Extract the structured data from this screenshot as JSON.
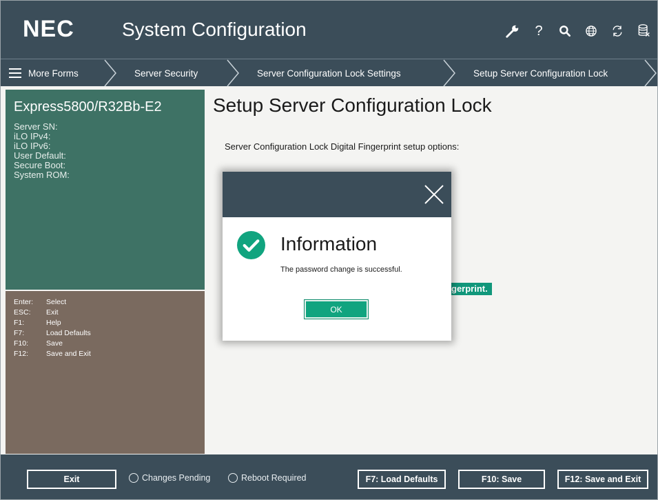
{
  "header": {
    "logo": "NEC",
    "title": "System Configuration",
    "icons": [
      "wrench-icon",
      "help-icon",
      "search-icon",
      "globe-icon",
      "refresh-icon",
      "database-icon"
    ],
    "help_glyph": "?"
  },
  "breadcrumb": {
    "menu_label": "More Forms",
    "items": [
      {
        "label": "Server Security"
      },
      {
        "label": "Server Configuration Lock Settings"
      },
      {
        "label": "Setup Server Configuration Lock"
      }
    ]
  },
  "system": {
    "model": "Express5800/R32Bb-E2",
    "fields": [
      "Server SN:",
      "iLO IPv4:",
      "iLO IPv6:",
      "User Default:",
      "Secure Boot:",
      "System ROM:"
    ]
  },
  "keys": [
    {
      "key": "Enter:",
      "action": "Select"
    },
    {
      "key": "ESC:",
      "action": "Exit"
    },
    {
      "key": "F1:",
      "action": "Help"
    },
    {
      "key": "F7:",
      "action": "Load Defaults"
    },
    {
      "key": "F10:",
      "action": "Save"
    },
    {
      "key": "F12:",
      "action": "Save and Exit"
    }
  ],
  "main": {
    "title": "Setup Server Configuration Lock",
    "subtitle": "Server Configuration Lock Digital Fingerprint setup options:",
    "partial_option": "gerprint."
  },
  "modal": {
    "title": "Information",
    "message": "The password change is successful.",
    "ok_label": "OK"
  },
  "footer": {
    "exit_label": "Exit",
    "changes_pending": "Changes Pending",
    "reboot_required": "Reboot Required",
    "load_defaults": "F7: Load Defaults",
    "save": "F10: Save",
    "save_exit": "F12: Save and Exit"
  },
  "colors": {
    "header_bg": "#3b4d59",
    "system_panel": "#3e7265",
    "keys_panel": "#7a6a5f",
    "accent": "#11a47f"
  }
}
